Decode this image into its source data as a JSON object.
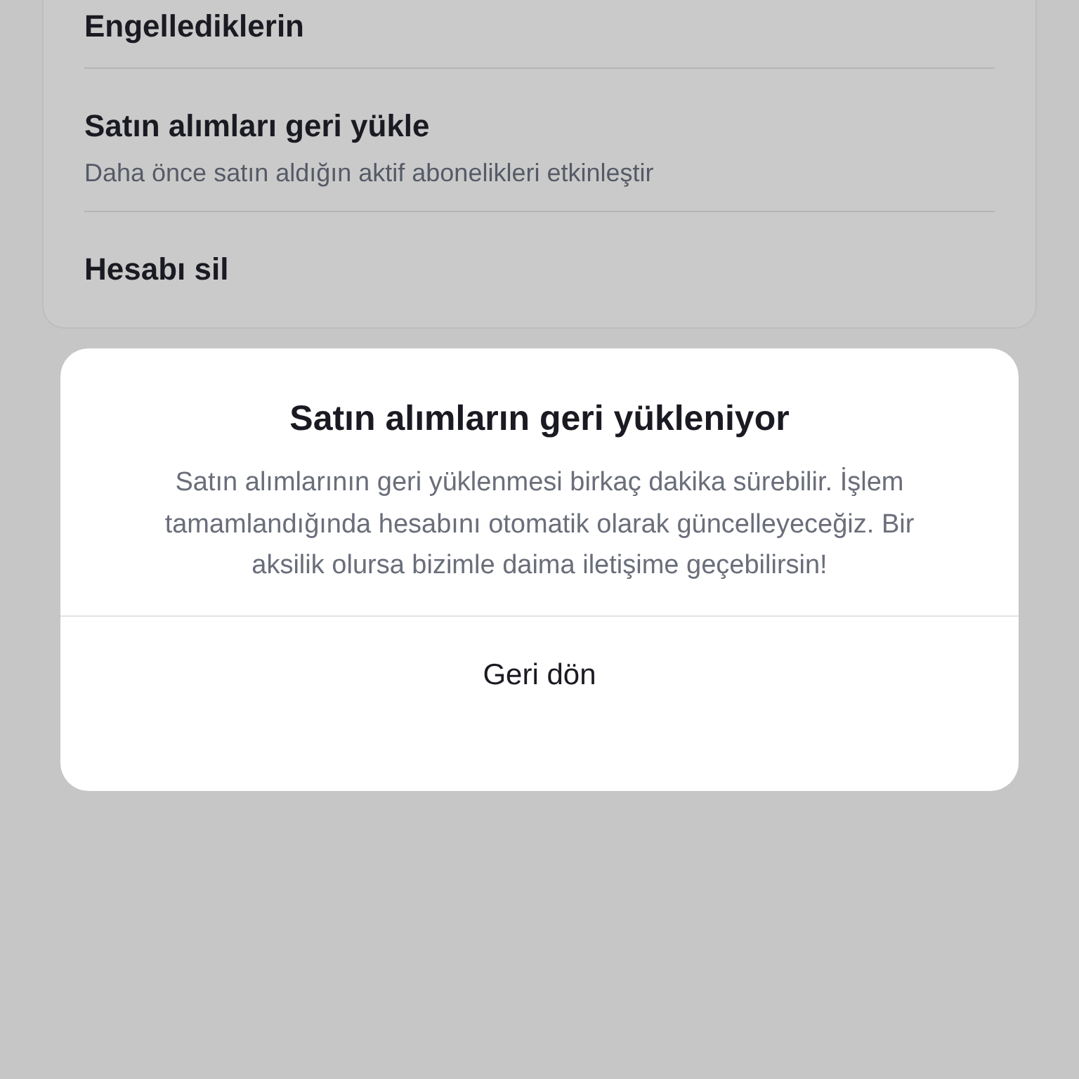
{
  "settings_items": [
    {
      "title": "Engellediklerin"
    },
    {
      "title": "Satın alımları geri yükle",
      "subtitle": "Daha önce satın aldığın aktif abonelikleri etkinleştir"
    },
    {
      "title": "Hesabı sil"
    }
  ],
  "dialog": {
    "title": "Satın alımların geri yükleniyor",
    "message": "Satın alımlarının geri yüklenmesi birkaç dakika sürebilir. İşlem tamamlandığında hesabını otomatik olarak güncelleyeceğiz. Bir aksilik olursa bizimle daima iletişime geçebilirsin!",
    "button": "Geri dön"
  }
}
